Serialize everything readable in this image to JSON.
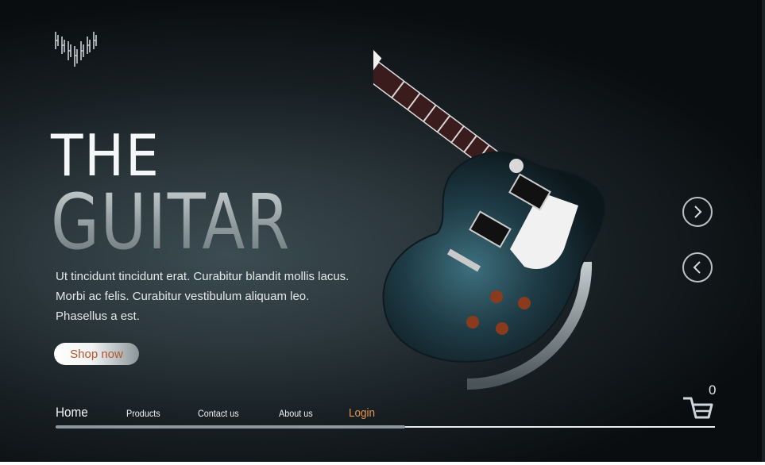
{
  "hero": {
    "title_line1": "THE",
    "title_line2": "GUITAR",
    "description": "Ut tincidunt tincidunt erat. Curabitur blandit mollis lacus. Morbi ac felis. Curabitur vestibulum aliquam leo. Phasellus a est.",
    "cta_label": "Shop now"
  },
  "carousel": {
    "next_icon": "chevron-right-icon",
    "prev_icon": "chevron-left-icon"
  },
  "nav": {
    "items": [
      {
        "label": "Home",
        "active": true
      },
      {
        "label": "Products"
      },
      {
        "label": "Contact us"
      },
      {
        "label": "About us"
      },
      {
        "label": "Login"
      }
    ]
  },
  "cart": {
    "icon": "cart-icon",
    "count": "0"
  },
  "colors": {
    "accent_login": "#e7954f",
    "cta_text": "#b4562c",
    "background_dark": "#0a0d0f",
    "background_mid": "#3c4c52"
  }
}
